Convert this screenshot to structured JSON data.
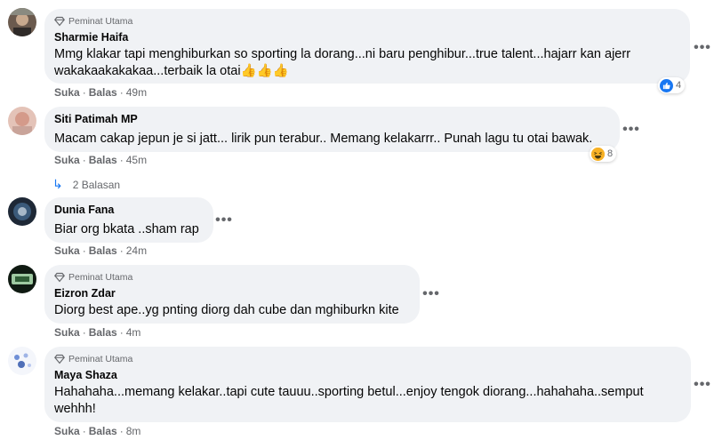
{
  "comments": [
    {
      "badge": "Peminat Utama",
      "author": "Sharmie Haifa",
      "text": "Mmg klakar tapi menghiburkan so sporting la dorang...ni baru penghibur...true talent...hajarr kan ajerr wakakaakakakaa...terbaik la otai👍👍👍",
      "like": "Suka",
      "reply": "Balas",
      "time": "49m",
      "reaction_count": "4"
    },
    {
      "author": "Siti Patimah MP",
      "text": "Macam cakap jepun je si jatt... lirik pun terabur.. Memang kelakarrr.. Punah lagu tu otai bawak.",
      "like": "Suka",
      "reply": "Balas",
      "time": "45m",
      "reaction_count": "8",
      "replies": "2 Balasan"
    },
    {
      "author": "Dunia Fana",
      "text": "Biar org bkata ..sham rap",
      "like": "Suka",
      "reply": "Balas",
      "time": "24m"
    },
    {
      "badge": "Peminat Utama",
      "author": "Eizron Zdar",
      "text": "Diorg best ape..yg pnting diorg dah cube dan mghiburkn kite",
      "like": "Suka",
      "reply": "Balas",
      "time": "4m"
    },
    {
      "badge": "Peminat Utama",
      "author": "Maya Shaza",
      "text": "Hahahaha...memang kelakar..tapi cute tauuu..sporting betul...enjoy tengok diorang...hahahaha..semput wehhh!",
      "like": "Suka",
      "reply": "Balas",
      "time": "8m"
    }
  ],
  "icons": {
    "badge": "diamond-icon",
    "more": "more-options-icon",
    "reaction_like": "like-reaction-icon",
    "reaction_haha": "haha-reaction-icon",
    "reply_arrow": "reply-arrow-icon"
  },
  "colors": {
    "bubble": "#f0f2f5",
    "meta": "#65676b",
    "like_blue": "#1877f2",
    "haha_yellow": "#f7b125"
  }
}
